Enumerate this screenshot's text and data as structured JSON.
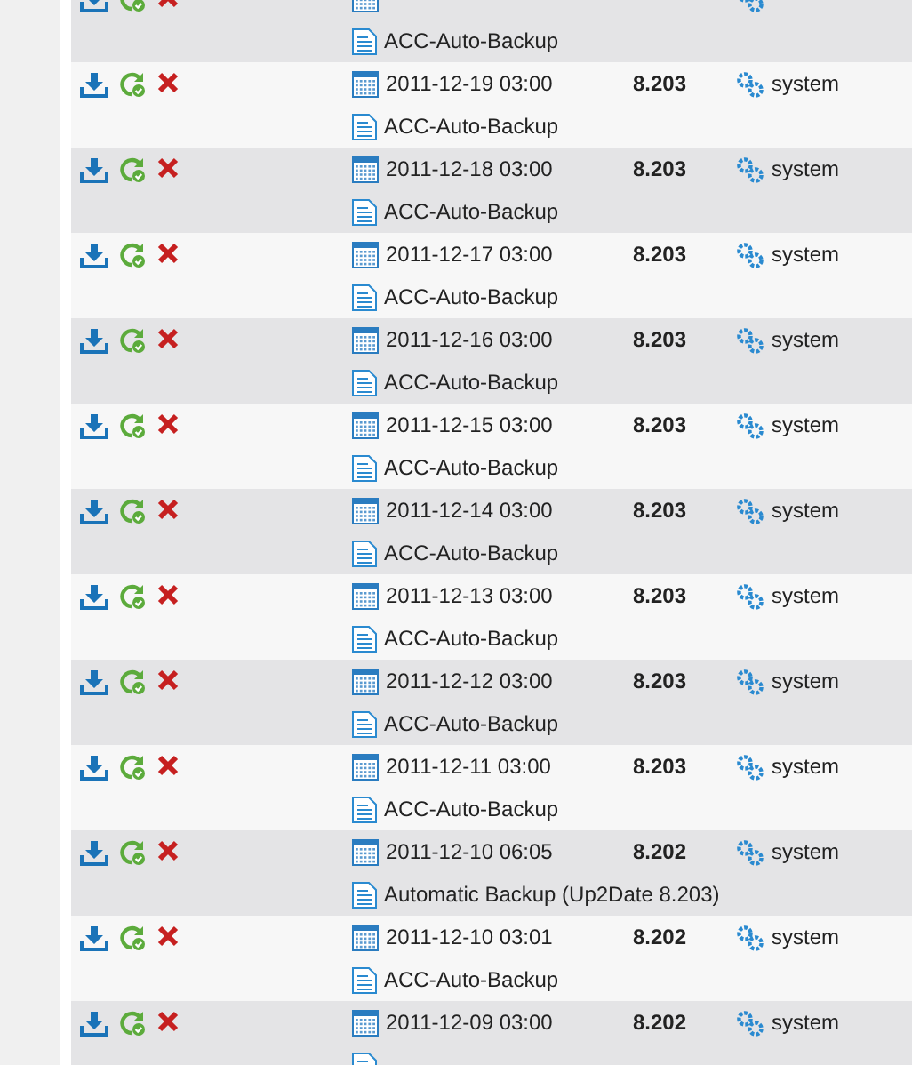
{
  "rows": [
    {
      "comment": "ACC-Auto-Backup"
    },
    {
      "date": "2011-12-19 03:00",
      "version": "8.203",
      "user": "system",
      "comment": "ACC-Auto-Backup"
    },
    {
      "date": "2011-12-18 03:00",
      "version": "8.203",
      "user": "system",
      "comment": "ACC-Auto-Backup"
    },
    {
      "date": "2011-12-17 03:00",
      "version": "8.203",
      "user": "system",
      "comment": "ACC-Auto-Backup"
    },
    {
      "date": "2011-12-16 03:00",
      "version": "8.203",
      "user": "system",
      "comment": "ACC-Auto-Backup"
    },
    {
      "date": "2011-12-15 03:00",
      "version": "8.203",
      "user": "system",
      "comment": "ACC-Auto-Backup"
    },
    {
      "date": "2011-12-14 03:00",
      "version": "8.203",
      "user": "system",
      "comment": "ACC-Auto-Backup"
    },
    {
      "date": "2011-12-13 03:00",
      "version": "8.203",
      "user": "system",
      "comment": "ACC-Auto-Backup"
    },
    {
      "date": "2011-12-12 03:00",
      "version": "8.203",
      "user": "system",
      "comment": "ACC-Auto-Backup"
    },
    {
      "date": "2011-12-11 03:00",
      "version": "8.203",
      "user": "system",
      "comment": "ACC-Auto-Backup"
    },
    {
      "date": "2011-12-10 06:05",
      "version": "8.202",
      "user": "system",
      "comment": "Automatic Backup (Up2Date 8.203)"
    },
    {
      "date": "2011-12-10 03:01",
      "version": "8.202",
      "user": "system",
      "comment": "ACC-Auto-Backup"
    },
    {
      "date": "2011-12-09 03:00",
      "version": "8.202",
      "user": "system"
    }
  ]
}
